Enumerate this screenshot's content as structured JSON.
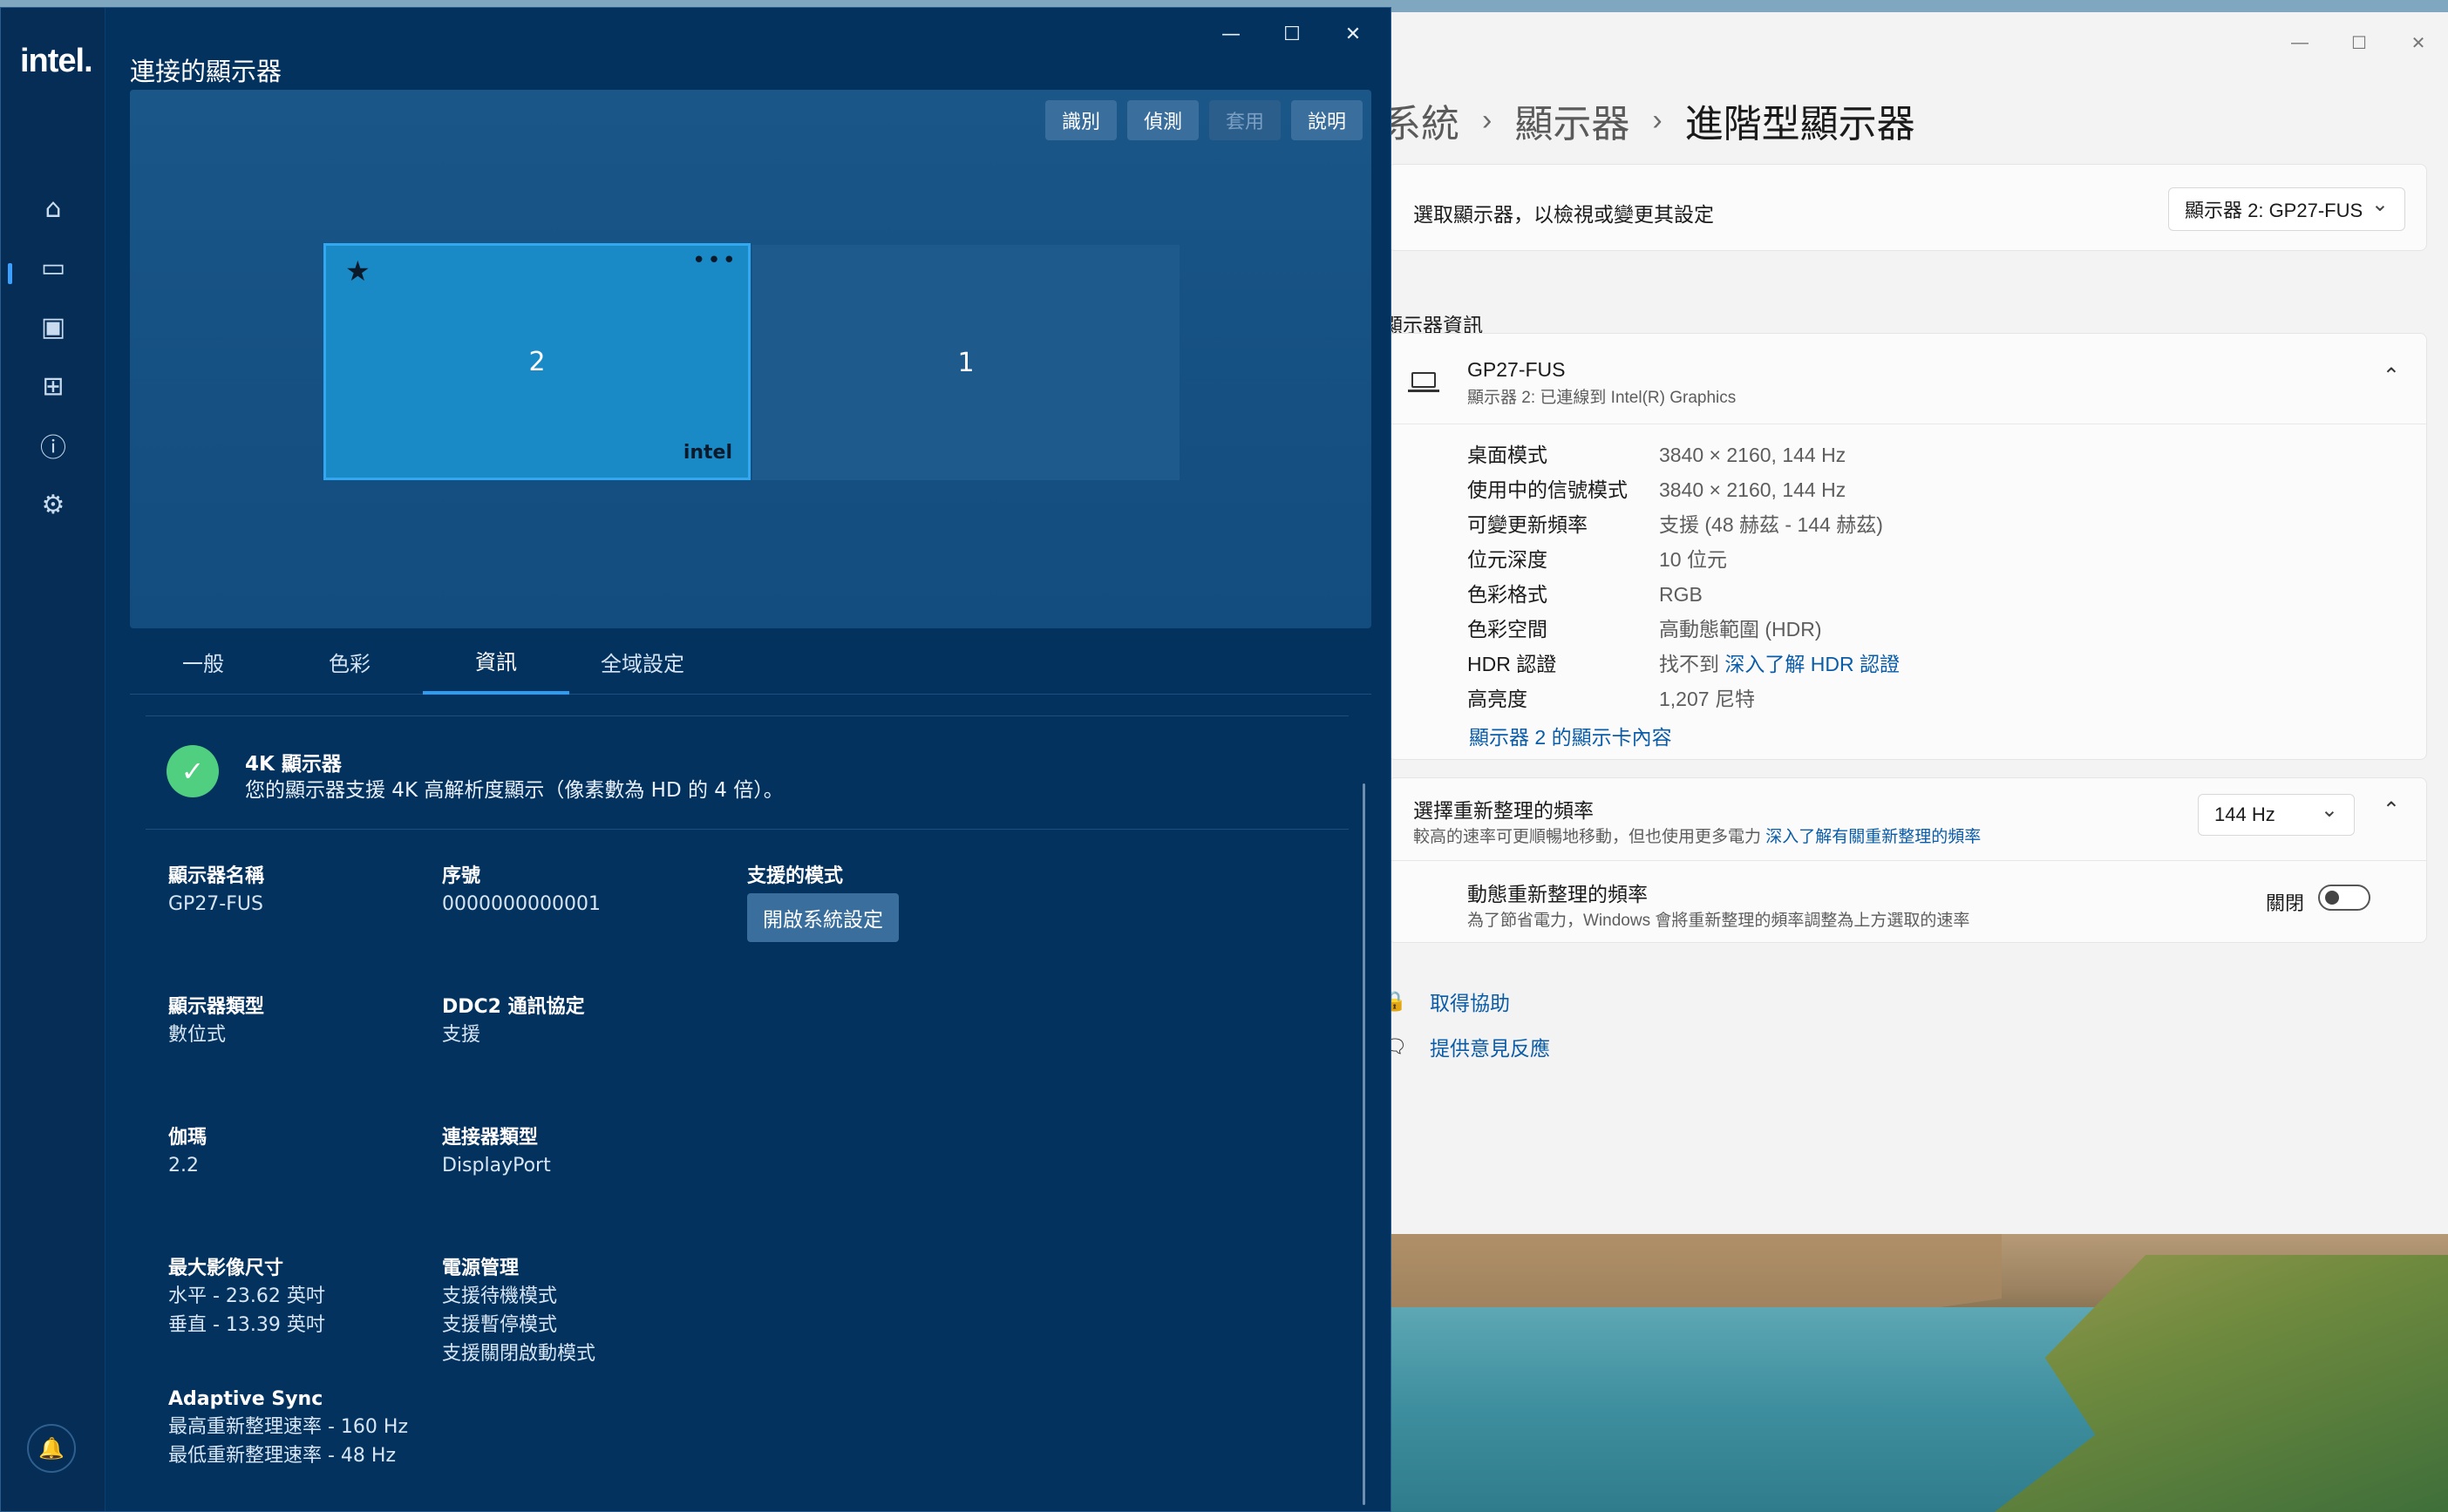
{
  "settings": {
    "breadcrumb": [
      "系統",
      "顯示器",
      "進階型顯示器"
    ],
    "select_label": "選取顯示器，以檢視或變更其設定",
    "select_value": "顯示器 2: GP27-FUS",
    "section_label": "顯示器資訊",
    "display_name": "GP27-FUS",
    "display_sub": "顯示器 2: 已連線到 Intel(R) Graphics",
    "info": [
      {
        "k": "桌面模式",
        "v": "3840 × 2160, 144 Hz"
      },
      {
        "k": "使用中的信號模式",
        "v": "3840 × 2160, 144 Hz"
      },
      {
        "k": "可變更新頻率",
        "v": "支援 (48 赫茲 - 144 赫茲)"
      },
      {
        "k": "位元深度",
        "v": "10 位元"
      },
      {
        "k": "色彩格式",
        "v": "RGB"
      },
      {
        "k": "色彩空間",
        "v": "高動態範圍 (HDR)"
      },
      {
        "k": "HDR 認證",
        "v": "找不到",
        "link": "深入了解 HDR 認證"
      },
      {
        "k": "高亮度",
        "v": "1,207 尼特"
      }
    ],
    "adapter_link": "顯示器 2 的顯示卡內容",
    "refresh_title": "選擇重新整理的頻率",
    "refresh_desc": "較高的速率可更順暢地移動，但也使用更多電力",
    "refresh_link": "深入了解有關重新整理的頻率",
    "refresh_value": "144 Hz",
    "dynamic_title": "動態重新整理的頻率",
    "dynamic_desc": "為了節省電力，Windows 會將重新整理的頻率調整為上方選取的速率",
    "dynamic_state": "關閉",
    "help": "取得協助",
    "feedback": "提供意見反應"
  },
  "intel": {
    "logo": "intel.",
    "title": "連接的顯示器",
    "buttons": {
      "identify": "識別",
      "detect": "偵測",
      "apply": "套用",
      "help": "說明"
    },
    "monitors": {
      "m2": "2",
      "m1": "1",
      "brand": "intel",
      "primary_star": "★",
      "menu": "•••"
    },
    "tabs": [
      "一般",
      "色彩",
      "資訊",
      "全域設定"
    ],
    "banner_title": "4K 顯示器",
    "banner_desc": "您的顯示器支援 4K 高解析度顯示（像素數為 HD 的 4 倍）。",
    "fields": {
      "name_k": "顯示器名稱",
      "name_v": "GP27-FUS",
      "serial_k": "序號",
      "serial_v": "0000000000001",
      "modes_k": "支援的模式",
      "modes_btn": "開啟系統設定",
      "type_k": "顯示器類型",
      "type_v": "數位式",
      "ddc_k": "DDC2 通訊協定",
      "ddc_v": "支援",
      "gamma_k": "伽瑪",
      "gamma_v": "2.2",
      "conn_k": "連接器類型",
      "conn_v": "DisplayPort",
      "size_k": "最大影像尺寸",
      "size_h": "水平 - 23.62 英吋",
      "size_v": "垂直 - 13.39 英吋",
      "power_k": "電源管理",
      "power_1": "支援待機模式",
      "power_2": "支援暫停模式",
      "power_3": "支援關閉啟動模式",
      "sync_k": "Adaptive Sync",
      "sync_max": "最高重新整理速率 - 160 Hz",
      "sync_min": "最低重新整理速率 - 48 Hz"
    }
  },
  "icons": [
    "home-icon",
    "display-icon",
    "media-icon",
    "apps-icon",
    "help-icon",
    "gear-icon",
    "bell-icon"
  ],
  "colors": {
    "intel_bg": "#04325e",
    "accent": "#2e9cf0",
    "link": "#0a5ca8"
  }
}
